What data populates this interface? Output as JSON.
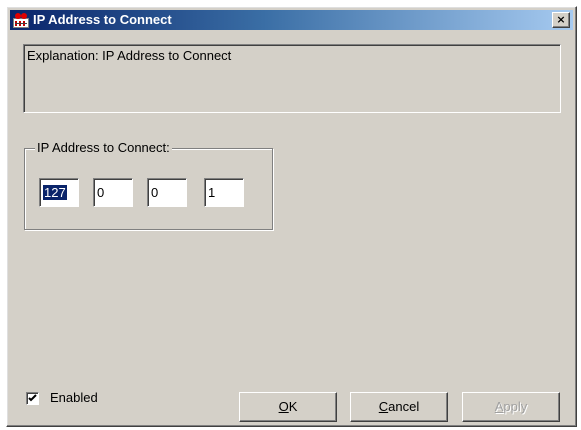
{
  "window": {
    "title": "IP Address to Connect",
    "close_glyph": "×"
  },
  "explanation": {
    "text": "Explanation: IP Address to Connect"
  },
  "ip_group": {
    "label": "IP Address to Connect:",
    "octets": [
      "127",
      "0",
      "0",
      "1"
    ],
    "selected_octet_index": 0
  },
  "enabled_checkbox": {
    "label": "Enabled",
    "checked": true
  },
  "buttons": {
    "ok": {
      "mnemonic": "O",
      "rest": "K",
      "enabled": true
    },
    "cancel": {
      "mnemonic": "C",
      "rest": "ancel",
      "enabled": true
    },
    "apply": {
      "mnemonic": "A",
      "rest": "pply",
      "enabled": false
    }
  },
  "colors": {
    "dialog_face": "#d4d0c8",
    "titlebar_start": "#0a246a",
    "titlebar_end": "#a6caf0",
    "selection": "#0a246a"
  },
  "icons": {
    "title": "app-icon",
    "close": "close-icon",
    "check": "checkmark-icon"
  }
}
